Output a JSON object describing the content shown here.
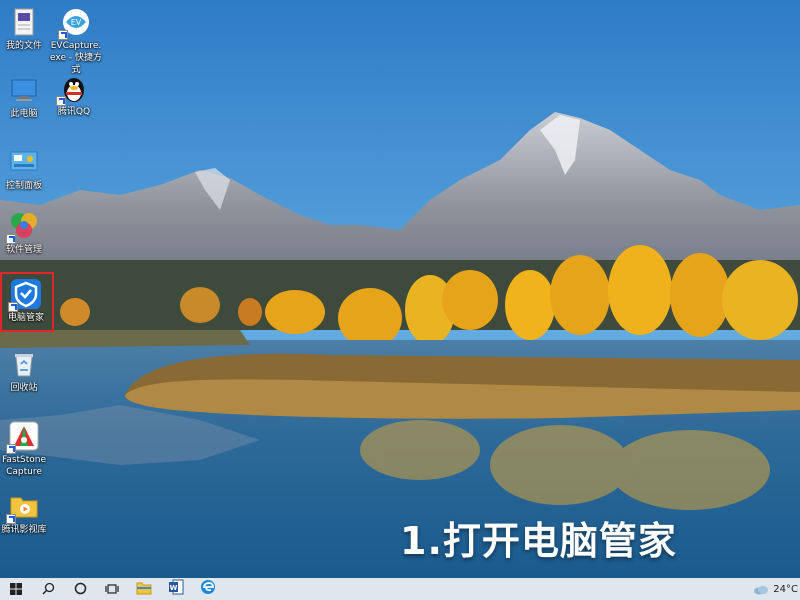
{
  "desktop": {
    "icons": [
      {
        "label": "我的文件"
      },
      {
        "label": "EVCapture.exe - 快捷方式"
      },
      {
        "label": "此电脑"
      },
      {
        "label": "腾讯QQ"
      },
      {
        "label": "控制面板"
      },
      {
        "label": "软件管理"
      },
      {
        "label": "电脑管家"
      },
      {
        "label": "回收站"
      },
      {
        "label": "FastStone Capture"
      },
      {
        "label": "腾讯影视库"
      }
    ],
    "caption": "1.打开电脑管家"
  },
  "taskbar": {
    "items": [
      "start-icon",
      "search-icon",
      "cortana-icon",
      "task-view-icon",
      "file-explorer-icon",
      "word-icon",
      "edge-icon"
    ],
    "weather": {
      "temperature": "24°C"
    }
  },
  "colors": {
    "highlight": "#e02828",
    "taskbar": "#dfe6ee",
    "sky": "#3f8fd2"
  }
}
